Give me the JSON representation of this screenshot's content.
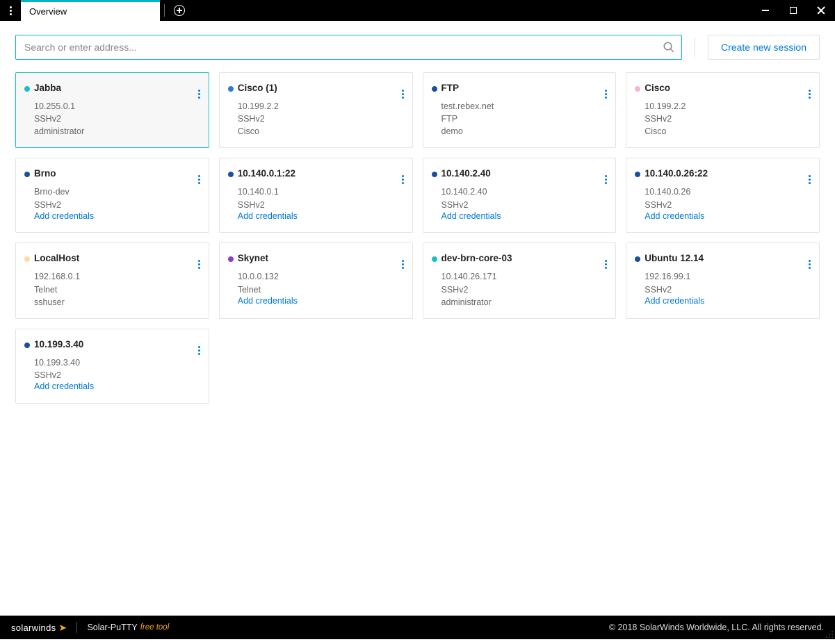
{
  "window": {
    "tab_title": "Overview"
  },
  "search": {
    "placeholder": "Search or enter address..."
  },
  "buttons": {
    "create_new_session": "Create new session"
  },
  "links": {
    "add_credentials": "Add credentials"
  },
  "colors": {
    "teal": "#17bfc8",
    "blue": "#2a7bdc",
    "darkblue": "#1a4e9e",
    "pink": "#f4b7d7",
    "peach": "#ffd9a6",
    "purple": "#8a3dcc"
  },
  "sessions": [
    {
      "name": "Jabba",
      "dot": "teal",
      "active": true,
      "lines": [
        "10.255.0.1",
        "SSHv2",
        "administrator"
      ],
      "add_credentials": false
    },
    {
      "name": "Cisco (1)",
      "dot": "blue",
      "active": false,
      "lines": [
        "10.199.2.2",
        "SSHv2",
        "Cisco"
      ],
      "add_credentials": false
    },
    {
      "name": "FTP",
      "dot": "darkblue",
      "active": false,
      "lines": [
        "test.rebex.net",
        "FTP",
        "demo"
      ],
      "add_credentials": false
    },
    {
      "name": "Cisco",
      "dot": "pink",
      "active": false,
      "lines": [
        "10.199.2.2",
        "SSHv2",
        "Cisco"
      ],
      "add_credentials": false
    },
    {
      "name": "Brno",
      "dot": "darkblue",
      "active": false,
      "lines": [
        "Brno-dev",
        "SSHv2"
      ],
      "add_credentials": true
    },
    {
      "name": "10.140.0.1:22",
      "dot": "darkblue",
      "active": false,
      "lines": [
        "10.140.0.1",
        "SSHv2"
      ],
      "add_credentials": true
    },
    {
      "name": "10.140.2.40",
      "dot": "darkblue",
      "active": false,
      "lines": [
        "10.140.2.40",
        "SSHv2"
      ],
      "add_credentials": true
    },
    {
      "name": "10.140.0.26:22",
      "dot": "darkblue",
      "active": false,
      "lines": [
        "10.140.0.26",
        "SSHv2"
      ],
      "add_credentials": true
    },
    {
      "name": "LocalHost",
      "dot": "peach",
      "active": false,
      "lines": [
        "192.168.0.1",
        "Telnet",
        "sshuser"
      ],
      "add_credentials": false
    },
    {
      "name": "Skynet",
      "dot": "purple",
      "active": false,
      "lines": [
        "10.0.0.132",
        "Telnet"
      ],
      "add_credentials": true
    },
    {
      "name": "dev-brn-core-03",
      "dot": "teal",
      "active": false,
      "lines": [
        "10.140.26.171",
        "SSHv2",
        "administrator"
      ],
      "add_credentials": false
    },
    {
      "name": "Ubuntu 12.14",
      "dot": "darkblue",
      "active": false,
      "lines": [
        "192.16.99.1",
        "SSHv2"
      ],
      "add_credentials": true
    },
    {
      "name": "10.199.3.40",
      "dot": "darkblue",
      "active": false,
      "lines": [
        "10.199.3.40",
        "SSHv2"
      ],
      "add_credentials": true
    }
  ],
  "footer": {
    "brand": "solarwinds",
    "product": "Solar-PuTTY",
    "tag": "free tool",
    "copyright": "© 2018 SolarWinds Worldwide, LLC. All rights reserved."
  }
}
